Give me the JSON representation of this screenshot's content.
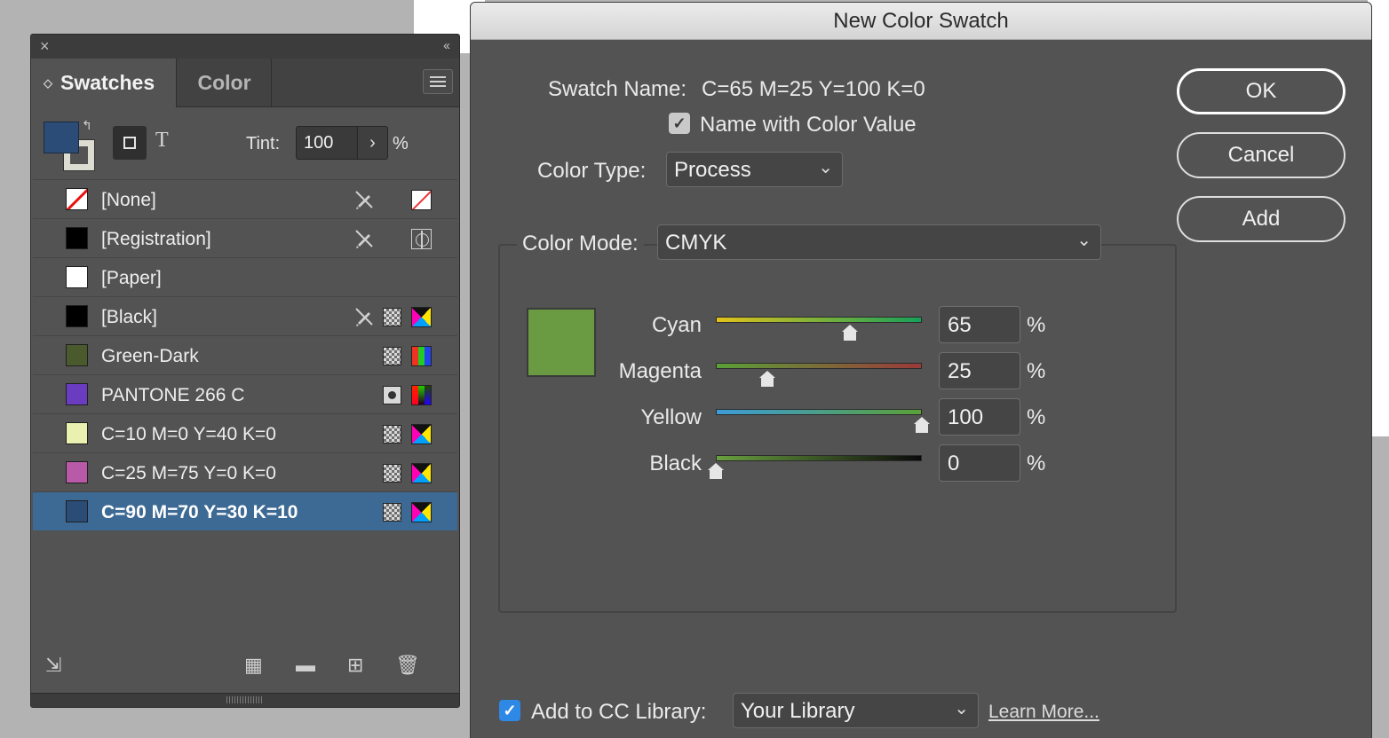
{
  "swatches_panel": {
    "close_icon": "×",
    "collapse_icon": "‹‹",
    "tabs": [
      "Swatches",
      "Color"
    ],
    "tint_label": "Tint:",
    "tint_value": "100",
    "tint_stepper": "›",
    "tint_unit": "%",
    "text_toggle": "T",
    "fill_color": "#2c4c78",
    "items": [
      {
        "name": "[None]",
        "color": "none",
        "editable_icon": "pencil-crossed-icon",
        "type_icon": "none-icon"
      },
      {
        "name": "[Registration]",
        "color": "#000000",
        "editable_icon": "pencil-crossed-icon",
        "type_icon": "registration-icon"
      },
      {
        "name": "[Paper]",
        "color": "#ffffff"
      },
      {
        "name": "[Black]",
        "color": "#000000",
        "editable_icon": "pencil-crossed-icon",
        "type_icon": "process-icon",
        "mode_icon": "cmyk-icon"
      },
      {
        "name": "Green-Dark",
        "color": "#4a5a2c",
        "type_icon": "process-icon",
        "mode_icon": "rgb-icon"
      },
      {
        "name": "PANTONE 266 C",
        "color": "#6a3cc0",
        "type_icon": "spot-icon",
        "mode_icon": "lab-icon"
      },
      {
        "name": "C=10 M=0 Y=40 K=0",
        "color": "#e9f0b0",
        "type_icon": "process-icon",
        "mode_icon": "cmyk-icon"
      },
      {
        "name": "C=25 M=75 Y=0 K=0",
        "color": "#b85aa8",
        "type_icon": "process-icon",
        "mode_icon": "cmyk-icon"
      },
      {
        "name": "C=90 M=70 Y=30 K=10",
        "color": "#2c4c78",
        "type_icon": "process-icon",
        "mode_icon": "cmyk-icon",
        "selected": true
      }
    ],
    "footer_icons": [
      "place-swatch-icon",
      "grid-view-icon",
      "folder-icon",
      "new-swatch-icon",
      "trash-icon"
    ]
  },
  "dialog": {
    "title": "New Color Swatch",
    "swatch_name_label": "Swatch Name:",
    "swatch_name_value": "C=65 M=25 Y=100 K=0",
    "name_with_color_value_label": "Name with Color Value",
    "name_with_color_value_checked": true,
    "color_type_label": "Color Type:",
    "color_type_value": "Process",
    "color_mode_label": "Color Mode:",
    "color_mode_value": "CMYK",
    "preview_color": "#6a9a42",
    "sliders": [
      {
        "label": "Cyan",
        "value": "65",
        "unit": "%",
        "fraction": 0.65
      },
      {
        "label": "Magenta",
        "value": "25",
        "unit": "%",
        "fraction": 0.25
      },
      {
        "label": "Yellow",
        "value": "100",
        "unit": "%",
        "fraction": 1.0
      },
      {
        "label": "Black",
        "value": "0",
        "unit": "%",
        "fraction": 0.0
      }
    ],
    "buttons": {
      "ok": "OK",
      "cancel": "Cancel",
      "add": "Add"
    },
    "cc_library_label": "Add to CC Library:",
    "cc_library_checked": true,
    "cc_library_value": "Your Library",
    "learn_more": "Learn More...",
    "checkmark": "✓",
    "caret": "⌄"
  }
}
